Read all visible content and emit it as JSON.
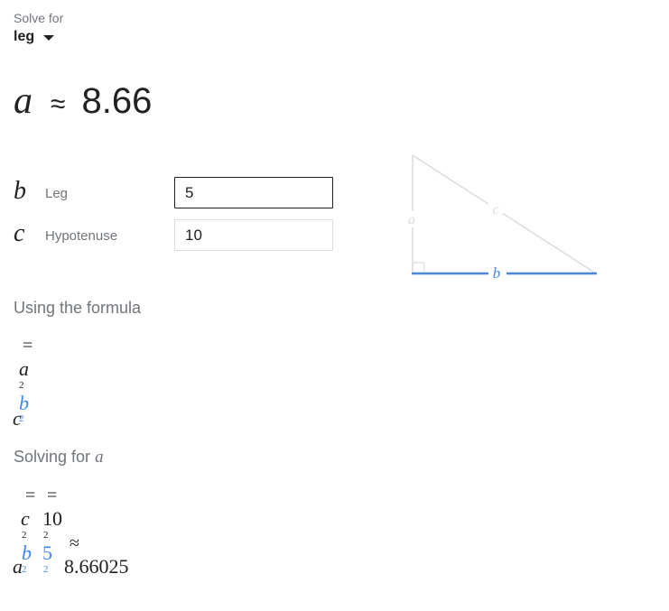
{
  "solve_for": {
    "label": "Solve for",
    "value": "leg"
  },
  "result": {
    "variable": "a",
    "approx_symbol": "≈",
    "value": "8.66"
  },
  "inputs": [
    {
      "variable": "b",
      "label": "Leg",
      "value": "5"
    },
    {
      "variable": "c",
      "label": "Hypotenuse",
      "value": "10"
    }
  ],
  "diagram": {
    "label_a": "a",
    "label_b": "b",
    "label_c": "c",
    "highlight_color": "#4a86d4",
    "muted_color": "#dadce0"
  },
  "formula_section": {
    "title": "Using the formula",
    "eq": "=",
    "a": "a",
    "b": "b",
    "c": "c",
    "exp": "2"
  },
  "solving_section": {
    "title_prefix": "Solving for",
    "title_var": "a",
    "eq1": "=",
    "eq2": "=",
    "approx": "≈",
    "c": "c",
    "b": "b",
    "a": "a",
    "exp": "2",
    "c_value": "10",
    "b_value": "5",
    "result": "8.66025"
  },
  "colors": {
    "accent_blue": "#4285f4",
    "muted_text": "#70757a",
    "text": "#202124"
  }
}
